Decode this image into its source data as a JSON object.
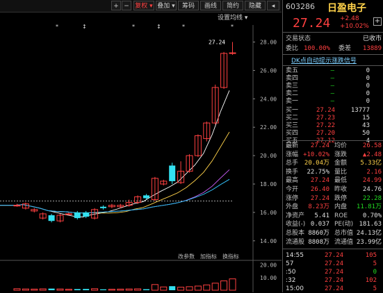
{
  "toolbar": {
    "buttons": [
      "+",
      "−",
      "复权 ▾",
      "叠加 ▾",
      "筹码",
      "画线",
      "简约",
      "隐藏"
    ],
    "collapse_label": "◂",
    "settings_label": "设置均线 ▾"
  },
  "chart_data": {
    "type": "candlestick",
    "ylim": [
      13.6,
      29.2
    ],
    "yticks": [
      "28.00",
      "26.00",
      "24.00",
      "22.00",
      "20.00",
      "18.00",
      "16.00",
      "14.00"
    ],
    "last_price_label": "27.24",
    "candles": [
      {
        "o": 16.5,
        "c": 16.5,
        "h": 16.6,
        "l": 16.4
      },
      {
        "o": 16.3,
        "c": 16.6,
        "h": 16.7,
        "l": 16.2
      },
      {
        "o": 16.1,
        "c": 16.2,
        "h": 16.3,
        "l": 16.0
      },
      {
        "o": 15.6,
        "c": 15.9,
        "h": 16.0,
        "l": 15.5
      },
      {
        "o": 15.8,
        "c": 15.4,
        "h": 15.9,
        "l": 15.3
      },
      {
        "o": 15.4,
        "c": 15.8,
        "h": 15.9,
        "l": 15.3
      },
      {
        "o": 15.9,
        "c": 15.9,
        "h": 16.0,
        "l": 15.8
      },
      {
        "o": 16.0,
        "c": 15.6,
        "h": 16.1,
        "l": 15.5
      },
      {
        "o": 16.0,
        "c": 15.7,
        "h": 16.1,
        "l": 15.6
      },
      {
        "o": 15.6,
        "c": 16.2,
        "h": 16.3,
        "l": 15.5
      },
      {
        "o": 16.4,
        "c": 16.3,
        "h": 16.5,
        "l": 16.2
      },
      {
        "o": 16.4,
        "c": 16.5,
        "h": 16.6,
        "l": 16.3
      },
      {
        "o": 16.4,
        "c": 16.5,
        "h": 16.6,
        "l": 16.3
      },
      {
        "o": 16.5,
        "c": 16.7,
        "h": 16.9,
        "l": 16.4
      },
      {
        "o": 16.7,
        "c": 17.1,
        "h": 17.2,
        "l": 16.6
      },
      {
        "o": 17.2,
        "c": 17.0,
        "h": 17.3,
        "l": 16.9
      },
      {
        "o": 16.9,
        "c": 18.4,
        "h": 18.5,
        "l": 16.8
      },
      {
        "o": 18.0,
        "c": 18.2,
        "h": 18.3,
        "l": 17.9
      },
      {
        "o": 19.3,
        "c": 18.2,
        "h": 19.5,
        "l": 18.0
      },
      {
        "o": 18.1,
        "c": 18.9,
        "h": 19.6,
        "l": 18.0
      },
      {
        "o": 18.9,
        "c": 20.0,
        "h": 20.1,
        "l": 18.8
      },
      {
        "o": 20.0,
        "c": 21.4,
        "h": 21.5,
        "l": 19.9
      },
      {
        "o": 21.2,
        "c": 22.3,
        "h": 22.4,
        "l": 21.0
      },
      {
        "o": 22.3,
        "c": 24.8,
        "h": 25.0,
        "l": 22.2
      },
      {
        "o": 24.8,
        "c": 27.2,
        "h": 27.3,
        "l": 24.7
      },
      {
        "o": 27.24,
        "c": 27.24,
        "h": 28.0,
        "l": 27.1
      }
    ],
    "markers": [
      "*",
      "↕",
      "*",
      "↕",
      "*",
      "*"
    ],
    "volume_yticks": [
      "20.00",
      "10.00"
    ],
    "volume_buttons": [
      "改参数",
      "加指标",
      "换指标"
    ],
    "volumes": [
      1.2,
      1.0,
      0.9,
      1.1,
      1.3,
      1.0,
      0.8,
      0.9,
      1.0,
      1.2,
      0.7,
      0.8,
      0.9,
      1.0,
      1.1,
      0.8,
      4.5,
      2.6,
      3.2,
      2.4,
      2.8,
      3.3,
      4.2,
      5.6,
      7.4,
      9.0
    ]
  },
  "panel": {
    "code": "603286",
    "name": "日盈电子",
    "price": "27.24",
    "change": "+2.48",
    "change_pct": "+10.02%",
    "status_label": "交易状态",
    "status_value": "已收市",
    "wb_label": "委比",
    "wb_value": "100.00%",
    "wc_label": "委差",
    "wc_value": "13889",
    "signal_text": "DK点自动提示涨跌信号",
    "asks": [
      {
        "label": "卖五",
        "price": "—",
        "vol": "0"
      },
      {
        "label": "卖四",
        "price": "—",
        "vol": "0"
      },
      {
        "label": "卖三",
        "price": "—",
        "vol": "0"
      },
      {
        "label": "卖二",
        "price": "—",
        "vol": "0"
      },
      {
        "label": "卖一",
        "price": "—",
        "vol": "0"
      }
    ],
    "bids": [
      {
        "label": "买一",
        "price": "27.24",
        "vol": "13777"
      },
      {
        "label": "买二",
        "price": "27.23",
        "vol": "15"
      },
      {
        "label": "买三",
        "price": "27.22",
        "vol": "43"
      },
      {
        "label": "买四",
        "price": "27.20",
        "vol": "50"
      },
      {
        "label": "买五",
        "price": "27.12",
        "vol": "4"
      }
    ],
    "stats": [
      {
        "l1": "最新",
        "v1": "27.24",
        "c1": "red",
        "l2": "均价",
        "v2": "26.58",
        "c2": "red"
      },
      {
        "l1": "涨幅",
        "v1": "+10.02%",
        "c1": "red",
        "l2": "涨跌",
        "v2": "▲2.48",
        "c2": "red"
      },
      {
        "l1": "总手",
        "v1": "20.04万",
        "c1": "yel",
        "l2": "金额",
        "v2": "5.33亿",
        "c2": "yel"
      },
      {
        "l1": "换手",
        "v1": "22.75%",
        "c1": "wht",
        "l2": "量比",
        "v2": "2.16",
        "c2": "red"
      },
      {
        "l1": "最高",
        "v1": "27.24",
        "c1": "red",
        "l2": "最低",
        "v2": "24.99",
        "c2": "red"
      },
      {
        "l1": "今开",
        "v1": "26.40",
        "c1": "red",
        "l2": "昨收",
        "v2": "24.76",
        "c2": "wht"
      },
      {
        "l1": "涨停",
        "v1": "27.24",
        "c1": "red",
        "l2": "跌停",
        "v2": "22.28",
        "c2": "grn"
      },
      {
        "l1": "外盘",
        "v1": "8.23万",
        "c1": "red",
        "l2": "内盘",
        "v2": "11.81万",
        "c2": "grn"
      },
      {
        "l1": "净资产",
        "v1": "5.41",
        "c1": "wht",
        "l2": "ROE",
        "v2": "0.70%",
        "c2": "wht"
      },
      {
        "l1": "收益(-)",
        "v1": "0.037",
        "c1": "wht",
        "l2": "PE(动)",
        "v2": "181.63",
        "c2": "wht"
      },
      {
        "l1": "总股本",
        "v1": "8860万",
        "c1": "wht",
        "l2": "总市值",
        "v2": "24.13亿",
        "c2": "wht"
      },
      {
        "l1": "流通股",
        "v1": "8808万",
        "c1": "wht",
        "l2": "流通值",
        "v2": "23.99亿",
        "c2": "wht"
      }
    ],
    "ticks": [
      {
        "time": "14:55",
        "price": "27.24",
        "vol": "105",
        "vc": "red"
      },
      {
        "time": "57",
        "price": "27.24",
        "vol": "5",
        "vc": "red"
      },
      {
        "time": ":50",
        "price": "27.24",
        "vol": "0",
        "vc": "grn"
      },
      {
        "time": ":32",
        "price": "27.24",
        "vol": "102",
        "vc": "red"
      },
      {
        "time": "15:00",
        "price": "27.24",
        "vol": "5",
        "vc": "red"
      }
    ]
  }
}
